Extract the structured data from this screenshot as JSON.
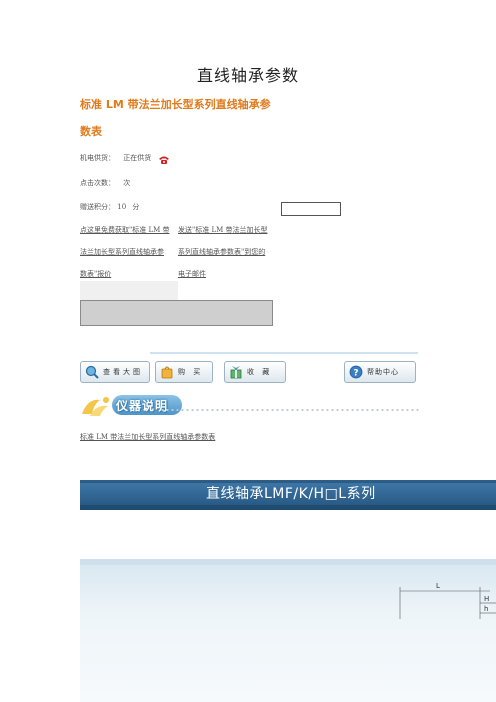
{
  "document": {
    "title": "直线轴承参数",
    "subtitle_line1": "标准 LM 带法兰加长型系列直线轴承参",
    "subtitle_line2": "数表"
  },
  "meta": {
    "supply_label": "机电供货：",
    "supply_value": "正在供货",
    "clicks_label": "点击次数：",
    "clicks_value": "次",
    "points_label": "赠送积分：",
    "points_value": "10",
    "points_unit": "分"
  },
  "offer": {
    "left_col": [
      "点这里免费获取\"标准 LM 带",
      "法兰加长型系列直线轴承参",
      "数表\"报价"
    ],
    "right_col": [
      "发送\"标准 LM 带法兰加长型",
      "系列直线轴承参数表\"到您的",
      "电子邮件"
    ]
  },
  "toolbar": {
    "buttons": [
      {
        "label": "查看大图",
        "icon": "magnifier-icon"
      },
      {
        "label": "购 买",
        "icon": "shopping-bag-icon"
      },
      {
        "label": "收 藏",
        "icon": "favorite-gift-icon"
      },
      {
        "label": "帮助中心",
        "icon": "help-icon"
      }
    ]
  },
  "section": {
    "heading": "仪器说明",
    "description": "标准 LM 带法兰加长型系列直线轴承参数表"
  },
  "banner": {
    "title": "直线轴承LMF/K/H□L系列",
    "dim_labels": [
      "L",
      "H",
      "h"
    ]
  },
  "colors": {
    "accent_orange": "#e07a1c",
    "banner_blue": "#2d5e86",
    "toolbar_border": "#9db3c4"
  }
}
